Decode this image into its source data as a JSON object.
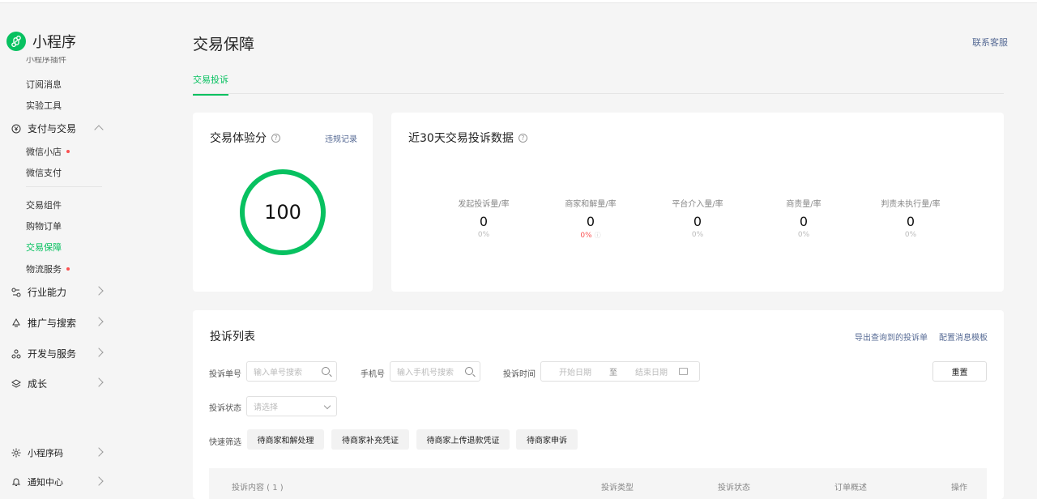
{
  "app": {
    "name": "小程序"
  },
  "sidebar": {
    "items": [
      {
        "label": "小程序插件"
      },
      {
        "label": "订阅消息"
      },
      {
        "label": "实验工具"
      },
      {
        "label": "支付与交易"
      },
      {
        "label": "微信小店"
      },
      {
        "label": "微信支付"
      },
      {
        "label": "交易组件"
      },
      {
        "label": "购物订单"
      },
      {
        "label": "交易保障"
      },
      {
        "label": "物流服务"
      },
      {
        "label": "行业能力"
      },
      {
        "label": "推广与搜索"
      },
      {
        "label": "开发与服务"
      },
      {
        "label": "成长"
      },
      {
        "label": "小程序码"
      },
      {
        "label": "通知中心"
      }
    ]
  },
  "header": {
    "title": "交易保障",
    "contact": "联系客服"
  },
  "tabs": [
    {
      "label": "交易投诉"
    }
  ],
  "score_card": {
    "title": "交易体验分",
    "link": "违规记录",
    "score": "100",
    "help": "?"
  },
  "stats_card": {
    "title": "近30天交易投诉数据",
    "help": "?",
    "stats": [
      {
        "label": "发起投诉量/率",
        "value": "0",
        "pct": "0%"
      },
      {
        "label": "商家和解量/率",
        "value": "0",
        "pct": "0%"
      },
      {
        "label": "平台介入量/率",
        "value": "0",
        "pct": "0%"
      },
      {
        "label": "商责量/率",
        "value": "0",
        "pct": "0%"
      },
      {
        "label": "判责未执行量/率",
        "value": "0",
        "pct": "0%"
      }
    ]
  },
  "list": {
    "title": "投诉列表",
    "export_link": "导出查询到的投诉单",
    "config_link": "配置消息模板",
    "filters": {
      "order_label": "投诉单号",
      "order_placeholder": "输入单号搜索",
      "phone_label": "手机号",
      "phone_placeholder": "输入手机号搜索",
      "time_label": "投诉时间",
      "start_placeholder": "开始日期",
      "to": "至",
      "end_placeholder": "结束日期",
      "status_label": "投诉状态",
      "status_placeholder": "请选择",
      "quick_label": "快速筛选",
      "reset": "重置"
    },
    "quick_filters": [
      {
        "label": "待商家和解处理"
      },
      {
        "label": "待商家补充凭证"
      },
      {
        "label": "待商家上传退款凭证"
      },
      {
        "label": "待商家申诉"
      }
    ],
    "columns": [
      {
        "label": "投诉内容 ( 1 )"
      },
      {
        "label": "投诉类型"
      },
      {
        "label": "投诉状态"
      },
      {
        "label": "订单概述"
      },
      {
        "label": "操作"
      }
    ]
  },
  "colors": {
    "accent": "#07c160",
    "link": "#576b95",
    "alert": "#fa5151"
  }
}
